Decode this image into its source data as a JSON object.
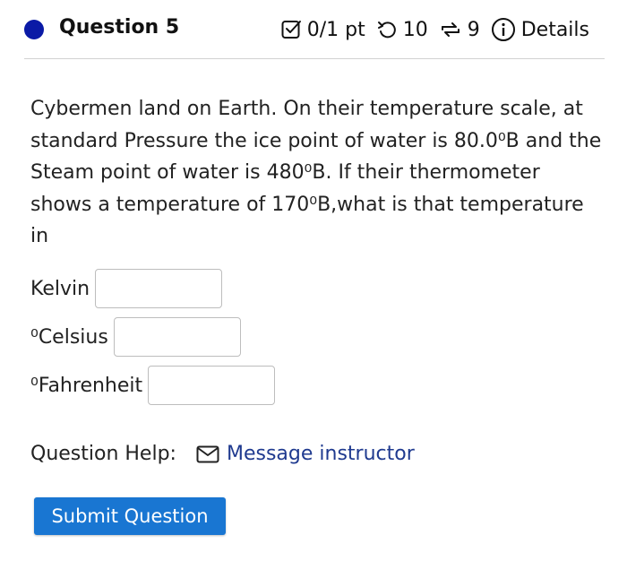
{
  "header": {
    "title": "Question 5",
    "points": "0/1 pt",
    "retries": "10",
    "attempts": "9",
    "details_label": "Details"
  },
  "question": {
    "text": "Cybermen land on Earth. On their temperature scale, at standard Pressure the ice point of water is 80.0⁰B and the Steam point of water is 480⁰B. If their thermometer shows a temperature of 170⁰B,what is that temperature in"
  },
  "answers": [
    {
      "label": "Kelvin",
      "value": ""
    },
    {
      "label": "⁰Celsius",
      "value": ""
    },
    {
      "label": "⁰Fahrenheit",
      "value": ""
    }
  ],
  "help": {
    "label": "Question Help:",
    "message_link": "Message instructor"
  },
  "submit_label": "Submit Question",
  "colors": {
    "status_dot": "#0a1aa6",
    "submit_bg": "#1976d2",
    "link": "#1f3a8f"
  },
  "icons": [
    "status-dot",
    "checkbox-icon",
    "retry-icon",
    "attempts-icon",
    "info-icon",
    "mail-icon"
  ]
}
